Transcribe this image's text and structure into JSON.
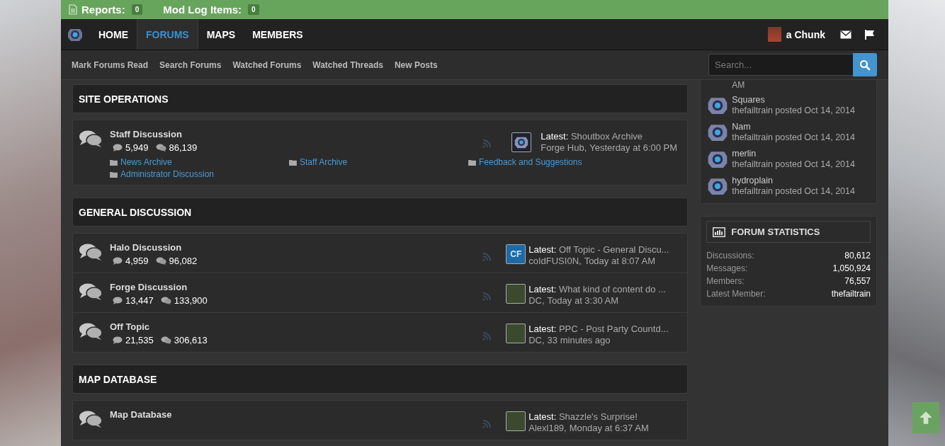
{
  "top_bar": {
    "reports": {
      "label": "Reports:",
      "count": "0"
    },
    "mod_log": {
      "label": "Mod Log Items:",
      "count": "0"
    }
  },
  "nav": {
    "tabs": [
      {
        "label": "HOME",
        "selected": false
      },
      {
        "label": "FORUMS",
        "selected": true
      },
      {
        "label": "MAPS",
        "selected": false
      },
      {
        "label": "MEMBERS",
        "selected": false
      }
    ],
    "user": "a Chunk"
  },
  "sub_nav": {
    "links": [
      "Mark Forums Read",
      "Search Forums",
      "Watched Forums",
      "Watched Threads",
      "New Posts"
    ],
    "search": {
      "placeholder": "Search..."
    }
  },
  "categories": [
    {
      "title": "SITE OPERATIONS",
      "forums": [
        {
          "title": "Staff Discussion",
          "discussions": "5,949",
          "messages": "86,139",
          "latest": {
            "label": "Latest:",
            "thread": "Shoutbox Archive",
            "user": "Forge Hub,",
            "time": "Yesterday at 6:00 PM",
            "kind": "logo"
          },
          "subforums": [
            "News Archive",
            "Staff Archive",
            "Feedback and Suggestions",
            "Administrator Discussion"
          ]
        }
      ]
    },
    {
      "title": "GENERAL DISCUSSION",
      "forums": [
        {
          "title": "Halo Discussion",
          "discussions": "4,959",
          "messages": "96,082",
          "latest": {
            "label": "Latest:",
            "thread": "Off Topic - General Discu...",
            "user": "coIdFUSI0N,",
            "time": "Today at 8:07 AM",
            "kind": "initials",
            "avatar_text": "CF"
          }
        },
        {
          "title": "Forge Discussion",
          "discussions": "13,447",
          "messages": "133,900",
          "latest": {
            "label": "Latest:",
            "thread": "What kind of content do ...",
            "user": "DC,",
            "time": "Today at 3:30 AM",
            "kind": "photo"
          }
        },
        {
          "title": "Off Topic",
          "discussions": "21,535",
          "messages": "306,613",
          "latest": {
            "label": "Latest:",
            "thread": "PPC - Post Party Countd...",
            "user": "DC,",
            "time": "33 minutes ago",
            "kind": "photo"
          }
        }
      ]
    },
    {
      "title": "MAP DATABASE",
      "forums": [
        {
          "title": "Map Database",
          "latest": {
            "label": "Latest:",
            "thread": "Shazzle's Surprise!",
            "user": "Alexl189,",
            "time": "Monday at 6:37 AM",
            "kind": "photo"
          }
        }
      ]
    }
  ],
  "sidebar": {
    "new_maps": {
      "cut_text": "AM",
      "items": [
        {
          "title": "Squares",
          "meta": "thefailtrain posted Oct 14, 2014"
        },
        {
          "title": "Nam",
          "meta": "thefailtrain posted Oct 14, 2014"
        },
        {
          "title": "merlin",
          "meta": "thefailtrain posted Oct 14, 2014"
        },
        {
          "title": "hydroplain",
          "meta": "thefailtrain posted Oct 14, 2014"
        }
      ]
    },
    "stats": {
      "title": "FORUM STATISTICS",
      "rows": [
        {
          "label": "Discussions:",
          "value": "80,612"
        },
        {
          "label": "Messages:",
          "value": "1,050,924"
        },
        {
          "label": "Members:",
          "value": "76,557"
        },
        {
          "label": "Latest Member:",
          "value": "thefailtrain"
        }
      ]
    }
  }
}
